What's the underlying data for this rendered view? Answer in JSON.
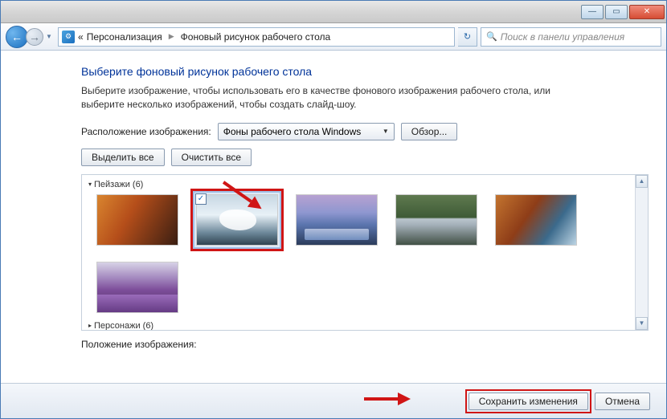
{
  "titlebar": {
    "minimize": "—",
    "maximize": "▭",
    "close": "✕"
  },
  "nav": {
    "back": "←",
    "forward": "→",
    "breadcrumb_prefix": "«",
    "breadcrumb1": "Персонализация",
    "breadcrumb2": "Фоновый рисунок рабочего стола",
    "refresh": "↻",
    "search_placeholder": "Поиск в панели управления"
  },
  "page": {
    "heading": "Выберите фоновый рисунок рабочего стола",
    "description": "Выберите изображение, чтобы использовать его в качестве фонового изображения рабочего стола, или выберите несколько изображений, чтобы создать слайд-шоу.",
    "location_label": "Расположение изображения:",
    "location_value": "Фоны рабочего стола Windows",
    "browse": "Обзор...",
    "select_all": "Выделить все",
    "clear_all": "Очистить все",
    "group1": "Пейзажи (6)",
    "group2": "Персонажи (6)",
    "position_label": "Положение изображения:",
    "checkmark": "✓"
  },
  "footer": {
    "save": "Сохранить изменения",
    "cancel": "Отмена"
  }
}
